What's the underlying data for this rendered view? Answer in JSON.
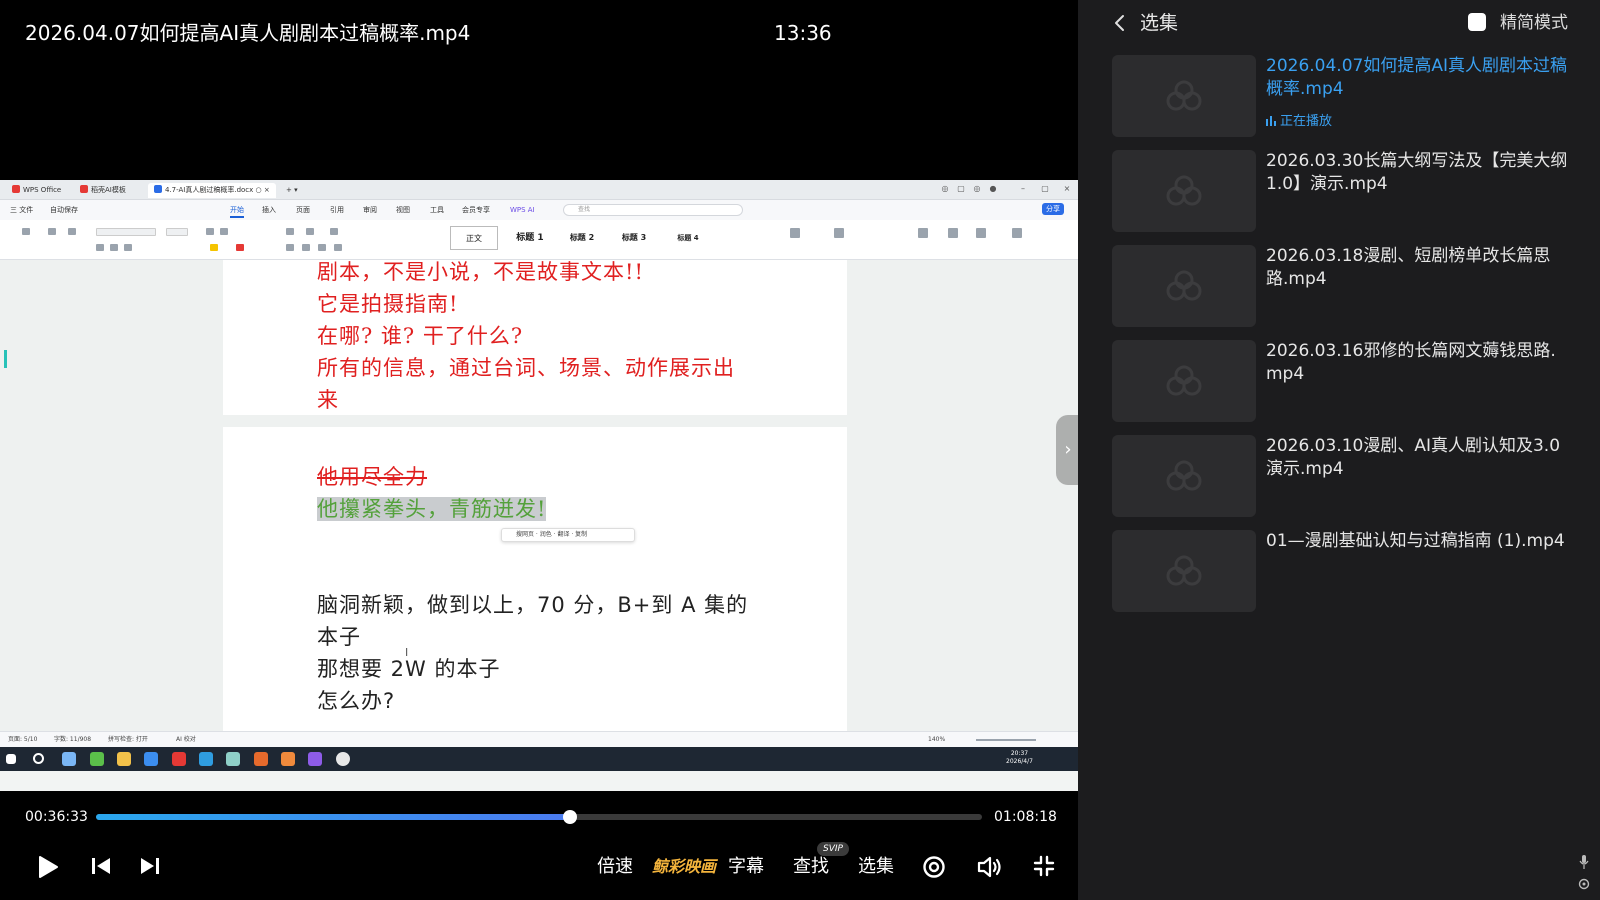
{
  "player": {
    "title": "2026.04.07如何提高AI真人剧剧本过稿概率.mp4",
    "clock": "13:36",
    "elapsed": "00:36:33",
    "total": "01:08:18",
    "progress": 0.535,
    "accent": "#2aa7ee"
  },
  "controls": {
    "speed": "倍速",
    "brand": "鲸彩映画",
    "subtitles": "字幕",
    "search": "查找",
    "svip": "SVIP",
    "episodes": "选集"
  },
  "sidebar": {
    "title": "选集",
    "simple_mode": "精简模式",
    "now_playing": "正在播放",
    "items": [
      {
        "title": "2026.04.07如何提高AI真人剧剧本过稿概率.mp4"
      },
      {
        "title": "2026.03.30长篇大纲写法及【完美大纲1.0】演示.mp4"
      },
      {
        "title": "2026.03.18漫剧、短剧榜单改长篇思路.mp4"
      },
      {
        "title": "2026.03.16邪修的长篇网文薅钱思路.mp4"
      },
      {
        "title": "2026.03.10漫剧、AI真人剧认知及3.0演示.mp4"
      },
      {
        "title": "01—漫剧基础认知与过稿指南 (1).mp4"
      }
    ]
  },
  "wps": {
    "tabs": [
      "WPS Office",
      "稻壳AI模板",
      "4.7-AI真人剧过稿概率.docx"
    ],
    "menu": [
      "三 文件",
      "自动保存",
      "开始",
      "插入",
      "页面",
      "引用",
      "审阅",
      "视图",
      "工具",
      "会员专享",
      "WPS AI"
    ],
    "search_placeholder": "查找",
    "share": "分享",
    "styles": [
      "正文",
      "标题 1",
      "标题 2",
      "标题 3",
      "标题 4"
    ],
    "mini_toolbar": "搜网页  · 润色 · 翻译 · 复制",
    "status": [
      "页面: 5/10",
      "字数: 11/908",
      "拼写检查: 打开",
      "AI 校对"
    ],
    "zoom": "140%",
    "taskbar_time": "20:37",
    "taskbar_date": "2026/4/7"
  },
  "document": {
    "page1": [
      "剧本，不是小说，不是故事文本!!",
      "它是拍摄指南!",
      "在哪? 谁? 干了什么?",
      "所有的信息，通过台词、场景、动作展示出",
      "来"
    ],
    "deleted": "他用尽全力",
    "inserted": "他攥紧拳头，青筋迸发!",
    "page2": [
      "脑洞新颖，做到以上，70 分，B+到 A 集的",
      "本子",
      "那想要 2W 的本子",
      "怎么办?"
    ]
  }
}
